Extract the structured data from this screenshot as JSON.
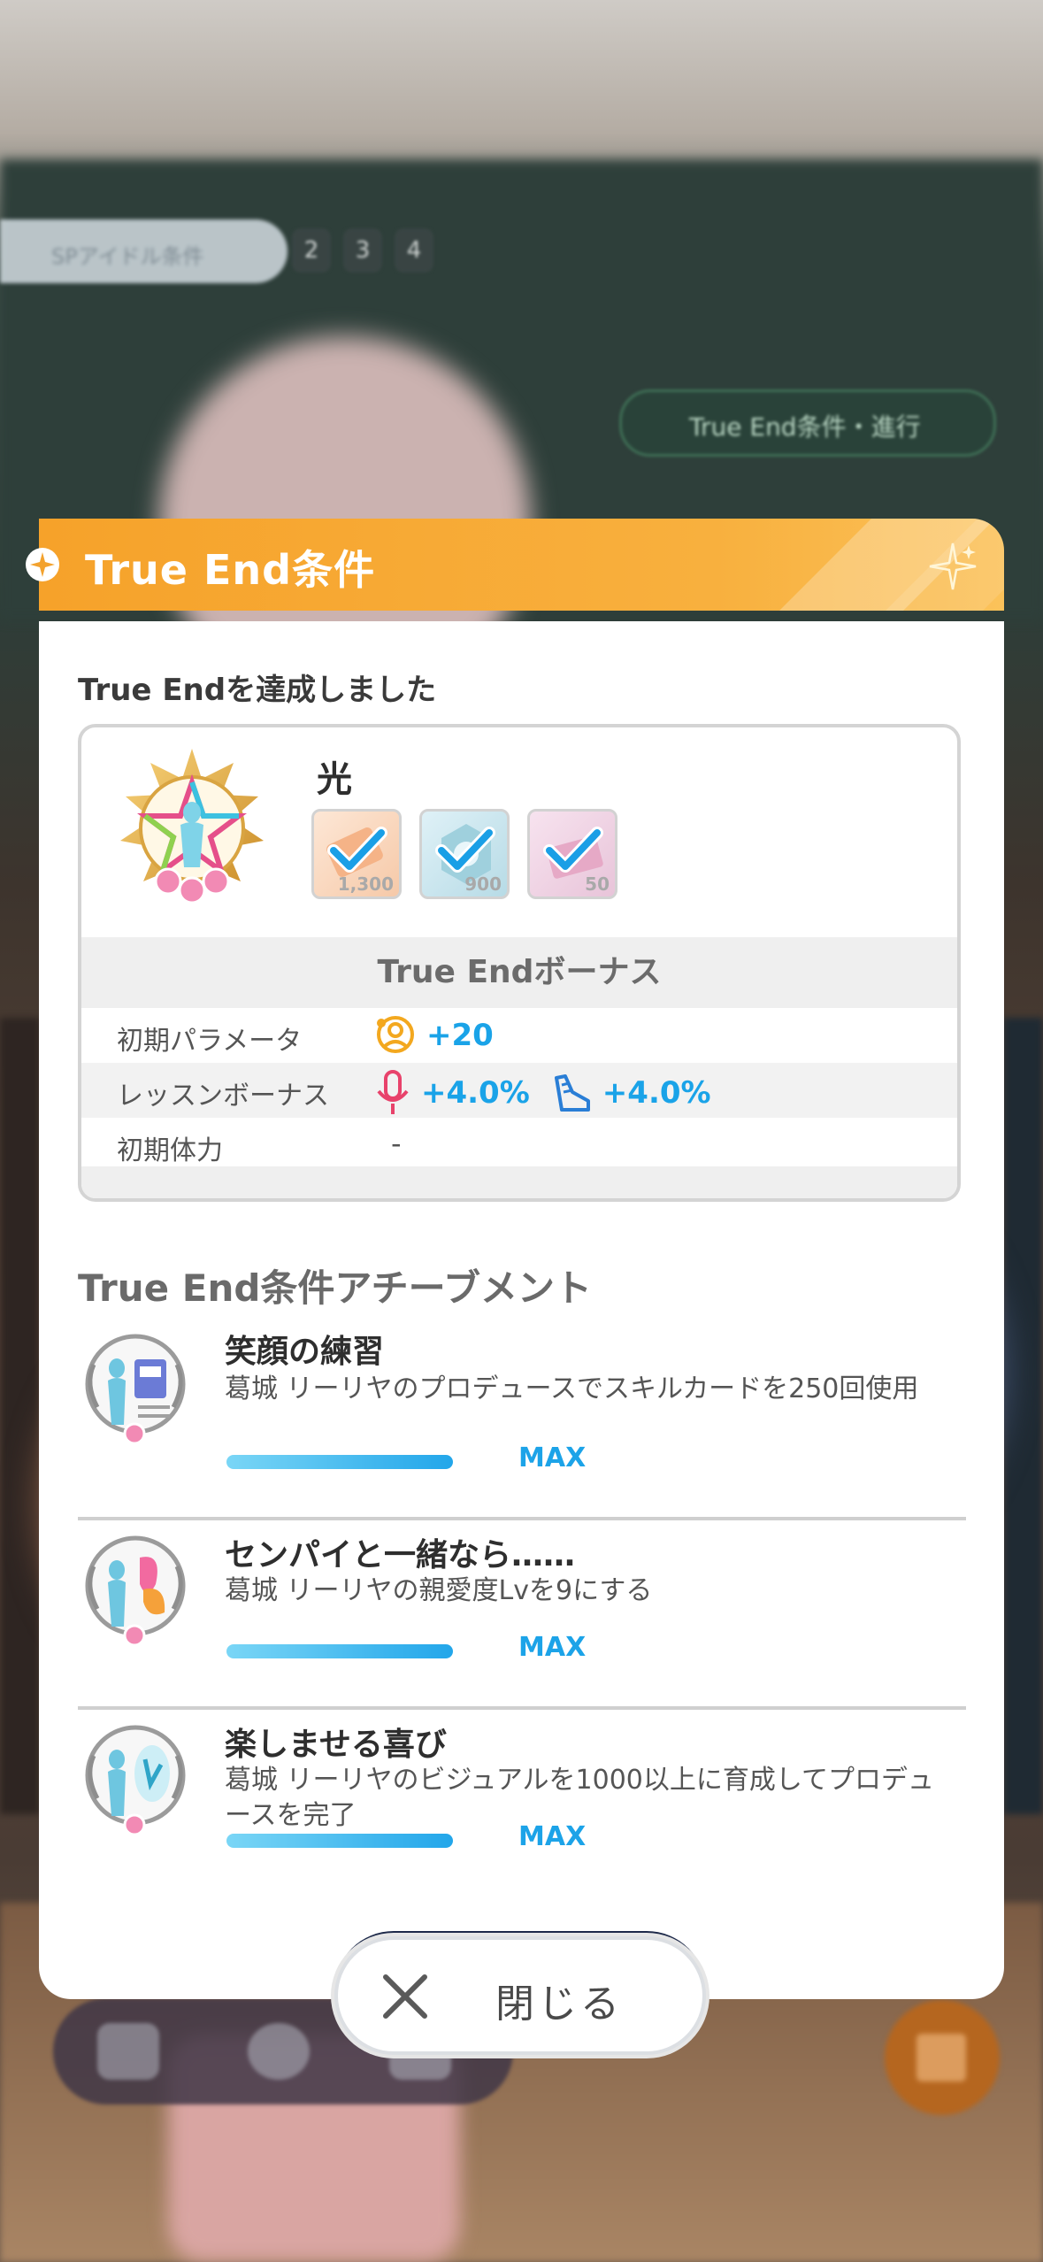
{
  "background": {
    "top_pill": "SPアイドル条件",
    "steps": [
      "2",
      "3",
      "4"
    ],
    "chip": "True End条件・進行"
  },
  "dialog": {
    "title": "True End条件",
    "achieved_text": "True Endを達成しました",
    "produce": {
      "name": "光",
      "items": [
        {
          "icon": "orange-ticket-icon",
          "count": "1,300",
          "checked": true
        },
        {
          "icon": "blue-gear-ticket-icon",
          "count": "900",
          "checked": true
        },
        {
          "icon": "pink-book-icon",
          "count": "50",
          "checked": true
        }
      ]
    },
    "bonus": {
      "heading": "True Endボーナス",
      "rows": [
        {
          "label": "初期パラメータ",
          "values": [
            {
              "icon": "all-param-icon",
              "text": "+20"
            }
          ]
        },
        {
          "label": "レッスンボーナス",
          "values": [
            {
              "icon": "vocal-mic-icon",
              "text": "+4.0%"
            },
            {
              "icon": "dance-shoe-icon",
              "text": "+4.0%"
            }
          ]
        },
        {
          "label": "初期体力",
          "values": [],
          "empty": "-"
        }
      ]
    },
    "achievements_heading": "True End条件アチーブメント",
    "achievements": [
      {
        "name": "笑顔の練習",
        "description": "葛城 リーリヤのプロデュースでスキルカードを250回使用",
        "progress": 1.0,
        "status": "MAX"
      },
      {
        "name": "センパイと一緒なら……",
        "description": "葛城 リーリヤの親愛度Lvを9にする",
        "progress": 1.0,
        "status": "MAX"
      },
      {
        "name": "楽しませる喜び",
        "description": "葛城 リーリヤのビジュアルを1000以上に育成してプロデュースを完了",
        "progress": 1.0,
        "status": "MAX"
      }
    ]
  },
  "close_button": {
    "label": "閉じる"
  },
  "colors": {
    "accent_orange": "#f6a22a",
    "value_blue": "#1aa3e8",
    "vocal_pink": "#e8426b"
  }
}
